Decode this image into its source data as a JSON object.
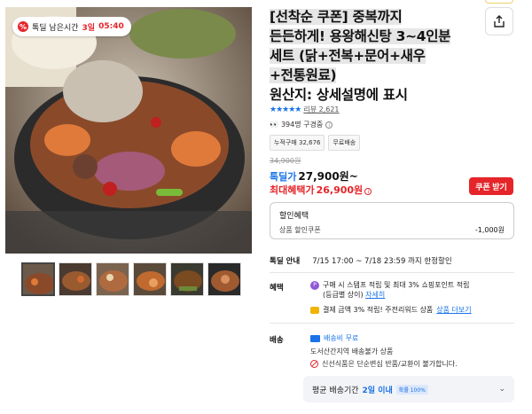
{
  "deal_chip": {
    "percent_icon": "%",
    "label": "톡딜 남은시간",
    "days": "3일",
    "time": "05:40"
  },
  "product": {
    "title_line1": "[선착순 쿠폰] 중복까지",
    "title_line2": "든든하게! 용왕해신탕 3~4인분",
    "title_line3": "세트 (닭+전복+문어+새우",
    "title_line4": "+전통원료)",
    "title_line5": "원산지: 상세설명에 표시"
  },
  "share_icon": "share-icon",
  "rating": {
    "stars": "★★★★★",
    "review_text": "리뷰 2,621",
    "color": "#1a73e8"
  },
  "viewers": {
    "eyes": "👀",
    "text": "394명 구경중"
  },
  "badges": [
    "누적구매 32,676",
    "무료배송"
  ],
  "price": {
    "original": "34,900원",
    "deal_label": "톡딜가",
    "deal_price": "27,900원~",
    "max_label": "최대혜택가",
    "max_price": "26,900원"
  },
  "coupon_button": "쿠폰 받기",
  "discount": {
    "title": "할인혜택",
    "name": "상품 할인쿠폰",
    "amount": "-1,000원"
  },
  "deal_info": {
    "label": "톡딜 안내",
    "text": "7/15 17:00 ~ 7/18 23:59 까지 한정할인"
  },
  "benefit": {
    "label": "혜택",
    "line1": "구매 시 스탬프 적립 및 최대 3% 쇼핑포인트 적립",
    "line1b": "(등급별 상이)",
    "line1_link": "자세히",
    "line2": "결제 금액 3% 적립! 주전리워드 상품",
    "line2_link": "상품 더보기"
  },
  "shipping": {
    "label": "배송",
    "free": "배송비 무료",
    "island": "도서산간지역 배송불가 상품",
    "fresh": "신선식품은 단순변심 반품/교환이 불가합니다.",
    "avg_label": "평균 배송기간",
    "avg_value": "2일 이내",
    "avg_pill": "확률 100%"
  },
  "colors": {
    "accent_red": "#e5252a",
    "accent_blue": "#1a73e8"
  }
}
